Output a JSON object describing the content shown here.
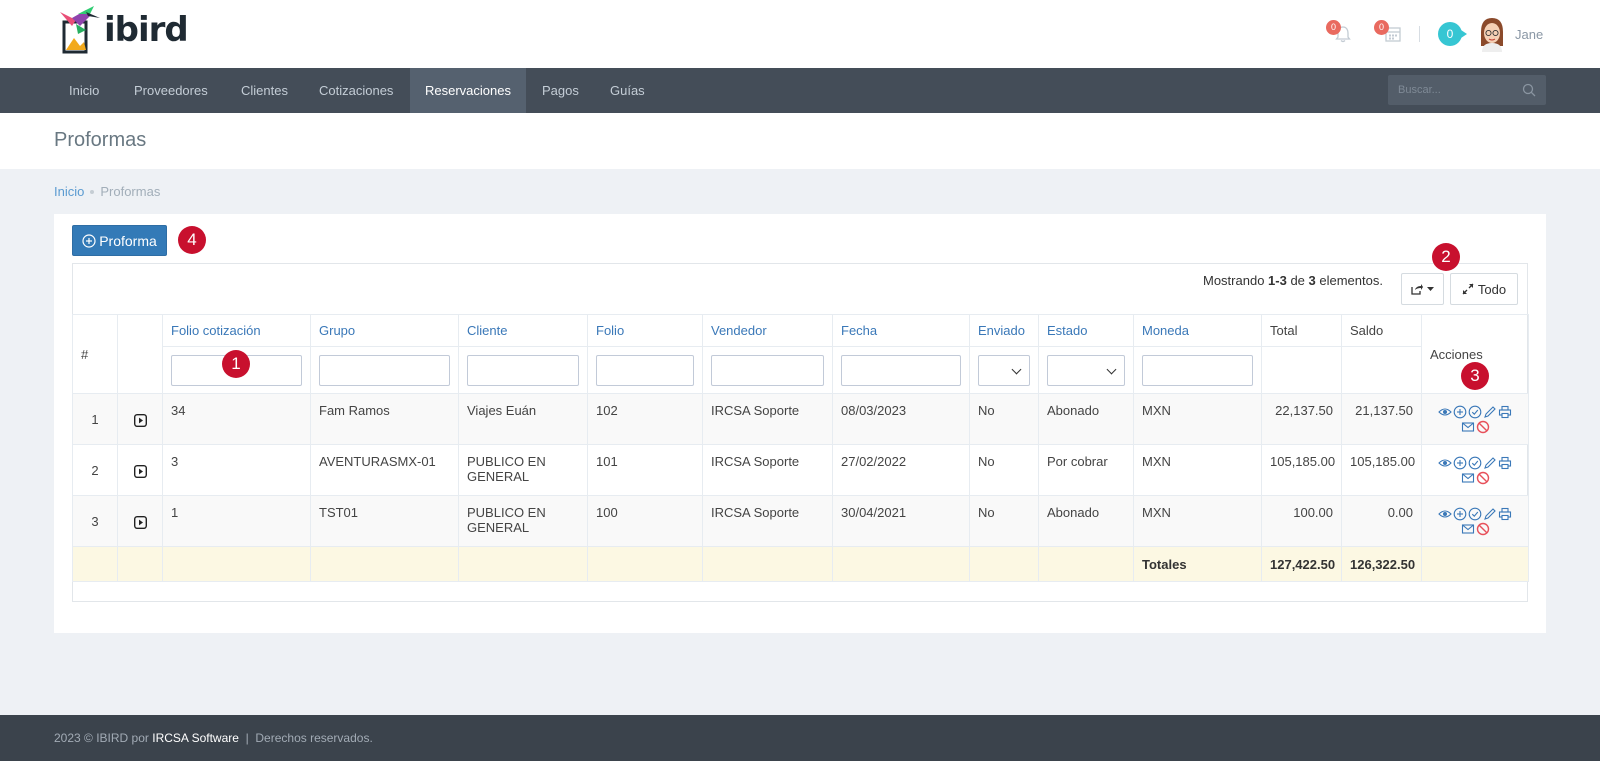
{
  "app": {
    "logo_text": "ibird",
    "notifications_count": "0",
    "calendar_count": "0",
    "messages_count": "0",
    "user_name": "Jane"
  },
  "nav": {
    "items": [
      "Inicio",
      "Proveedores",
      "Clientes",
      "Cotizaciones",
      "Reservaciones",
      "Pagos",
      "Guías"
    ],
    "active": "Reservaciones",
    "search_placeholder": "Buscar..."
  },
  "page": {
    "title": "Proformas",
    "breadcrumb": [
      "Inicio",
      "Proformas"
    ]
  },
  "toolbar": {
    "add_label": "Proforma",
    "summary_prefix": "Mostrando ",
    "summary_range": "1-3",
    "summary_mid": " de ",
    "summary_total": "3",
    "summary_suffix": " elementos.",
    "all_label": "Todo"
  },
  "markers": [
    "1",
    "2",
    "3",
    "4"
  ],
  "table": {
    "columns": {
      "num": "#",
      "folio_cot": "Folio cotización",
      "grupo": "Grupo",
      "cliente": "Cliente",
      "folio": "Folio",
      "vendedor": "Vendedor",
      "fecha": "Fecha",
      "enviado": "Enviado",
      "estado": "Estado",
      "moneda": "Moneda",
      "total": "Total",
      "saldo": "Saldo",
      "acciones": "Acciones"
    },
    "rows": [
      {
        "num": "1",
        "folio_cot": "34",
        "grupo": "Fam Ramos",
        "cliente": "Viajes Euán",
        "folio": "102",
        "vendedor": "IRCSA Soporte",
        "fecha": "08/03/2023",
        "enviado": "No",
        "estado": "Abonado",
        "moneda": "MXN",
        "total": "22,137.50",
        "saldo": "21,137.50"
      },
      {
        "num": "2",
        "folio_cot": "3",
        "grupo": "AVENTURASMX-01",
        "cliente": "PUBLICO EN GENERAL",
        "folio": "101",
        "vendedor": "IRCSA Soporte",
        "fecha": "27/02/2022",
        "enviado": "No",
        "estado": "Por cobrar",
        "moneda": "MXN",
        "total": "105,185.00",
        "saldo": "105,185.00"
      },
      {
        "num": "3",
        "folio_cot": "1",
        "grupo": "TST01",
        "cliente": "PUBLICO EN GENERAL",
        "folio": "100",
        "vendedor": "IRCSA Soporte",
        "fecha": "30/04/2021",
        "enviado": "No",
        "estado": "Abonado",
        "moneda": "MXN",
        "total": "100.00",
        "saldo": "0.00"
      }
    ],
    "totals": {
      "label": "Totales",
      "total": "127,422.50",
      "saldo": "126,322.50"
    },
    "action_icons": [
      "eye-icon",
      "plus-circle-icon",
      "check-circle-icon",
      "pencil-icon",
      "print-icon",
      "envelope-icon",
      "ban-icon"
    ]
  },
  "footer": {
    "prefix": "2023 © IBIRD por ",
    "brand": "IRCSA Software",
    "suffix": "  |  Derechos reservados."
  },
  "colors": {
    "nav_bg": "#444d58",
    "primary": "#337ab7",
    "marker": "#c8102e",
    "link": "#3a78b8",
    "badge": "#e96a5f",
    "totals_bg": "#fcf8e3"
  }
}
